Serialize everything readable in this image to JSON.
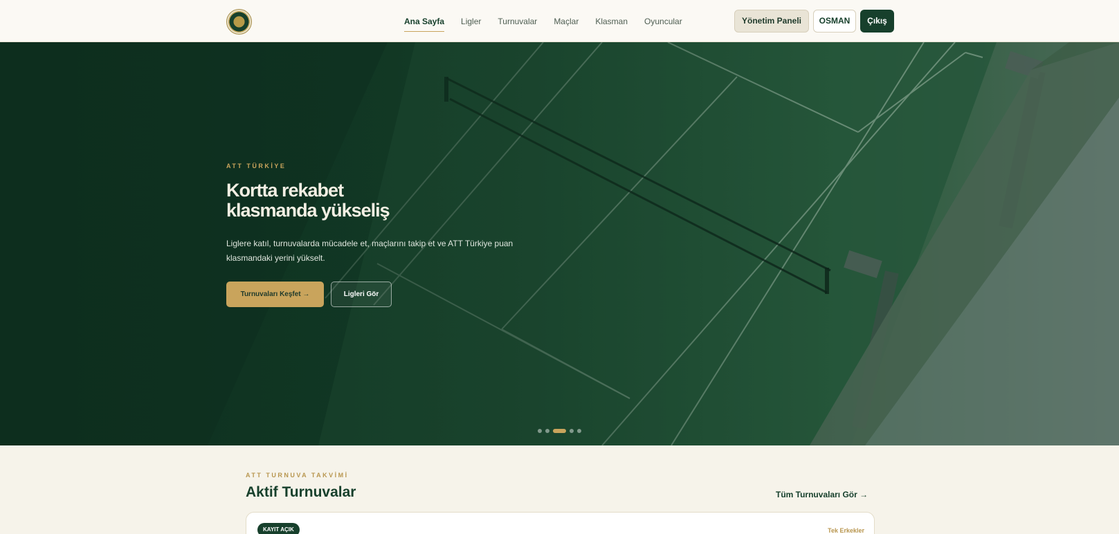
{
  "header": {
    "logo_icon": "att-turkiye-emblem",
    "nav": [
      "Ana Sayfa",
      "Ligler",
      "Turnuvalar",
      "Maçlar",
      "Klasman",
      "Oyuncular"
    ],
    "active_nav": "Ana Sayfa",
    "admin_label": "Yönetim Paneli",
    "user_label": "OSMAN",
    "logout_label": "Çıkış"
  },
  "hero": {
    "eyebrow": "ATT TÜRKİYE",
    "title_line1": "Kortta rekabet",
    "title_line2": "klasmanda yükseliş",
    "description": "Liglere katıl, turnuvalarda mücadele et, maçlarını takip et ve ATT Türkiye puan klasmandaki yerini yükselt.",
    "primary_button": "Turnuvaları Keşfet →",
    "secondary_button": "Ligleri Gör",
    "slides_total": 5,
    "active_slide": 3
  },
  "section": {
    "eyebrow": "ATT TURNUVA TAKVİMİ",
    "title": "Aktif Turnuvalar",
    "link": "Tüm Turnuvaları Gör →",
    "card": {
      "status_badge": "KAYIT AÇIK",
      "category": "Tek Erkekler"
    }
  },
  "colors": {
    "brand_green": "#17402c",
    "accent_gold": "#c9a45c",
    "page_bg": "#f6f3ea"
  }
}
